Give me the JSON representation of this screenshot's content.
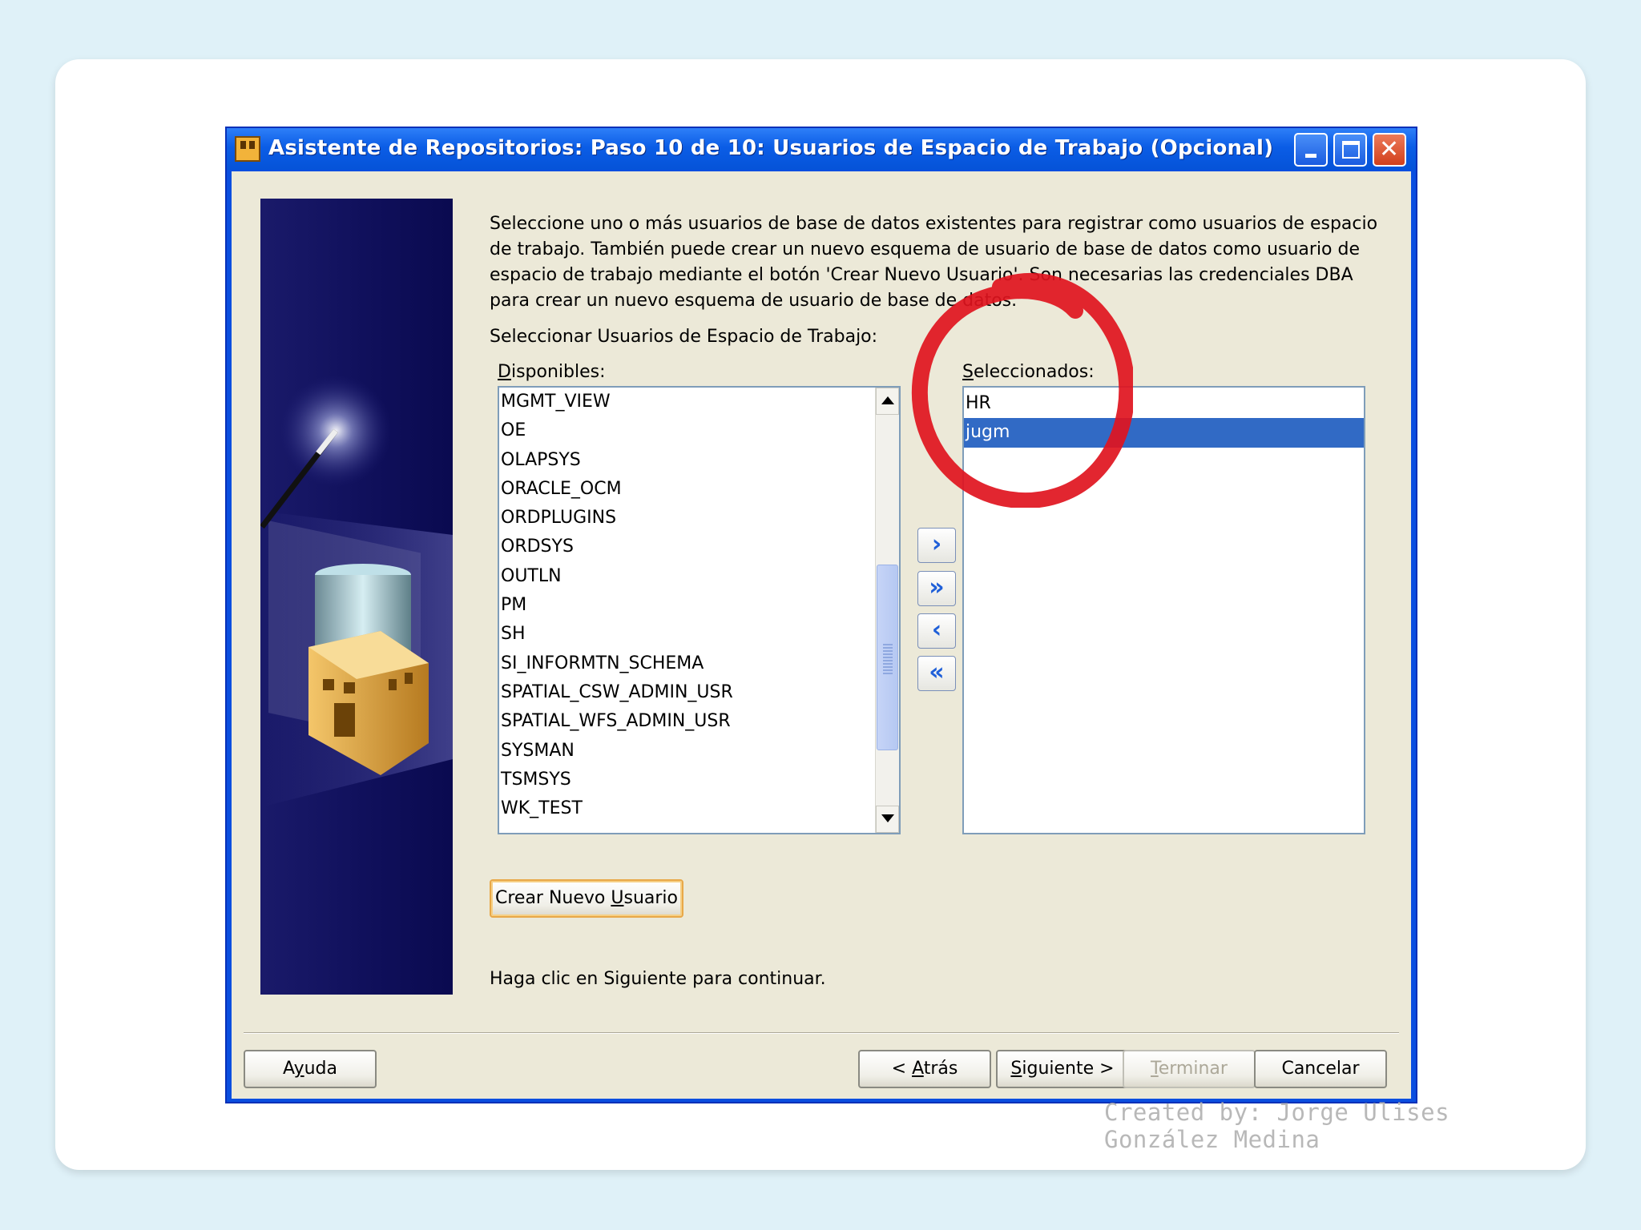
{
  "window": {
    "title": "Asistente de Repositorios: Paso 10 de 10: Usuarios de Espacio de Trabajo (Opcional)"
  },
  "content": {
    "description": "Seleccione uno o más usuarios de base de datos existentes para registrar como usuarios de espacio de trabajo. También puede crear un nuevo esquema de usuario de base de datos como usuario de espacio de trabajo mediante el botón 'Crear Nuevo Usuario'. Son necesarias las credenciales DBA para crear un nuevo esquema de usuario de base de datos.",
    "select_label": "Seleccionar Usuarios de Espacio de Trabajo:",
    "available_label_first": "D",
    "available_label_rest": "isponibles:",
    "selected_label_first": "S",
    "selected_label_rest": "eleccionados:",
    "available_items": [
      "MGMT_VIEW",
      "OE",
      "OLAPSYS",
      "ORACLE_OCM",
      "ORDPLUGINS",
      "ORDSYS",
      "OUTLN",
      "PM",
      "SH",
      "SI_INFORMTN_SCHEMA",
      "SPATIAL_CSW_ADMIN_USR",
      "SPATIAL_WFS_ADMIN_USR",
      "SYSMAN",
      "TSMSYS",
      "WK_TEST"
    ],
    "selected_items": [
      "HR",
      "jugm"
    ],
    "selected_highlight": "jugm",
    "move_buttons": {
      "add": "›",
      "add_all": "»",
      "remove": "‹",
      "remove_all": "«"
    },
    "create_button_a": "Crear Nuevo ",
    "create_button_u": "U",
    "create_button_b": "suario",
    "continue_text": "Haga clic en Siguiente para continuar."
  },
  "footer": {
    "help_a": "A",
    "help_u": "y",
    "help_b": "uda",
    "back_a": "< ",
    "back_u": "A",
    "back_b": "trás",
    "next_u": "S",
    "next_b": "iguiente >",
    "finish_u": "T",
    "finish_b": "erminar",
    "cancel": "Cancelar"
  },
  "watermark": {
    "line1": "Created by: Jorge Ulises",
    "line2": "González Medina"
  },
  "colors": {
    "title_bar": "#0b5de6",
    "selection": "#316ac5",
    "dialog_bg": "#ece9d8",
    "annotation": "#e0141e"
  }
}
